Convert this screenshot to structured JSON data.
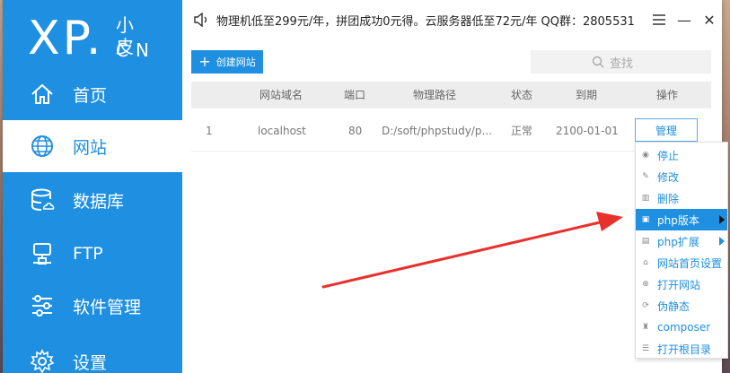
{
  "logo": {
    "big": "XP.",
    "small": "小皮",
    "cn": "CN"
  },
  "nav": [
    {
      "label": "首页",
      "icon": "home-icon"
    },
    {
      "label": "网站",
      "icon": "globe-icon",
      "active": true
    },
    {
      "label": "数据库",
      "icon": "database-icon"
    },
    {
      "label": "FTP",
      "icon": "ftp-icon"
    },
    {
      "label": "软件管理",
      "icon": "sliders-icon"
    },
    {
      "label": "设置",
      "icon": "gear-icon"
    }
  ],
  "topbar": {
    "notice": "物理机低至299元/年，拼团成功0元得。云服务器低至72元/年  QQ群：2805531",
    "menu_icon": "hamburger-icon",
    "minimize": "—",
    "close": "✕"
  },
  "toolbar": {
    "create_label": "创建网站",
    "search_placeholder": "查找"
  },
  "table": {
    "headers": [
      "网站域名",
      "端口",
      "物理路径",
      "状态",
      "到期",
      "操作"
    ],
    "rows": [
      {
        "index": "1",
        "domain": "localhost",
        "port": "80",
        "path": "D:/soft/phpstudy/p...",
        "status": "正常",
        "expire": "2100-01-01",
        "action": "管理"
      }
    ]
  },
  "context_menu": [
    {
      "label": "停止",
      "icon": "stop-icon"
    },
    {
      "label": "修改",
      "icon": "pencil-icon"
    },
    {
      "label": "删除",
      "icon": "trash-icon"
    },
    {
      "label": "php版本",
      "icon": "php-icon",
      "submenu": true,
      "highlighted": true
    },
    {
      "label": "php扩展",
      "icon": "extension-icon",
      "submenu": true
    },
    {
      "label": "网站首页设置",
      "icon": "home-icon"
    },
    {
      "label": "打开网站",
      "icon": "globe-icon"
    },
    {
      "label": "伪静态",
      "icon": "rewrite-icon"
    },
    {
      "label": "composer",
      "icon": "composer-icon"
    },
    {
      "label": "打开根目录",
      "icon": "folder-icon"
    }
  ],
  "colors": {
    "accent": "#1e8fe1",
    "arrow": "#e8312c"
  }
}
